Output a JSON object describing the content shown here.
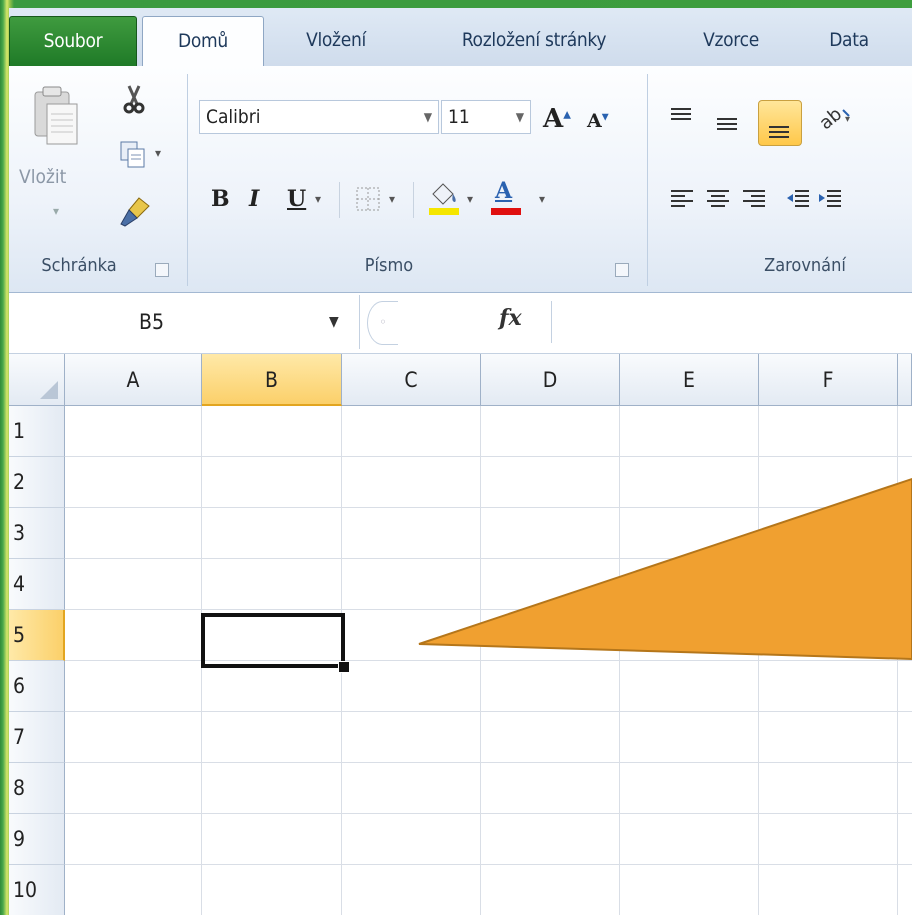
{
  "ribbon_tabs": {
    "file": "Soubor",
    "home": "Domů",
    "insert": "Vložení",
    "page_layout": "Rozložení stránky",
    "formulas": "Vzorce",
    "data": "Data"
  },
  "clipboard": {
    "paste_label": "Vložit",
    "group_label": "Schránka"
  },
  "font": {
    "family": "Calibri",
    "size": "11",
    "group_label": "Písmo",
    "bold": "B",
    "italic": "I",
    "underline": "U",
    "font_color_letter": "A",
    "grow_letter": "A",
    "shrink_letter": "A"
  },
  "alignment": {
    "group_label": "Zarovnání"
  },
  "formula_bar": {
    "name_box": "B5",
    "fx": "fx",
    "formula": ""
  },
  "sheet": {
    "columns": [
      "A",
      "B",
      "C",
      "D",
      "E",
      "F"
    ],
    "rows": [
      "1",
      "2",
      "3",
      "4",
      "5",
      "6",
      "7",
      "8",
      "9",
      "10"
    ],
    "selected_column": "B",
    "selected_row": "5",
    "active_cell": "B5"
  },
  "colors": {
    "file_tab": "#2a8a32",
    "selection_header": "#fbd06a",
    "callout": "#f0a030"
  },
  "icons": [
    "scissors-icon",
    "copy-icon",
    "format-painter-icon",
    "paste-icon",
    "borders-icon",
    "fill-color-icon",
    "font-color-icon",
    "align-top-icon",
    "align-middle-icon",
    "align-bottom-icon",
    "orientation-icon",
    "align-left-icon",
    "align-center-icon",
    "align-right-icon",
    "decrease-indent-icon",
    "increase-indent-icon"
  ]
}
